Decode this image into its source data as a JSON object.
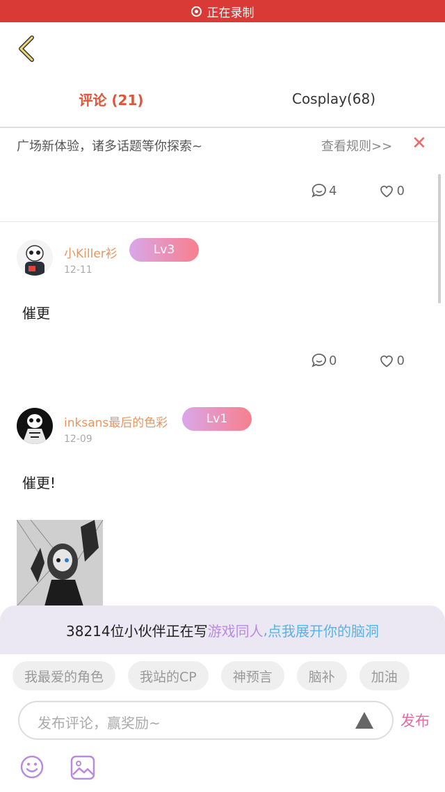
{
  "recording": {
    "label": "正在录制"
  },
  "tabs": [
    {
      "label": "评论 (21)"
    },
    {
      "label": "Cosplay(68)"
    }
  ],
  "notice": {
    "text": "广场新体验，诸多话题等你探索~",
    "rules": "查看规则>>",
    "close": "✕"
  },
  "post0": {
    "comments": "4",
    "likes": "0"
  },
  "comments": [
    {
      "user": "小Killer衫",
      "level": "Lv3",
      "date": "12-11",
      "text": "催更",
      "comments": "0",
      "likes": "0"
    },
    {
      "user": "inksans最后的色彩",
      "level": "Lv1",
      "date": "12-09",
      "text": "催更!"
    }
  ],
  "bottom": {
    "banner_prefix": "38214位小伙伴正在写",
    "banner_hl1": "游戏同人",
    "banner_sep": ",",
    "banner_hl2": "点我展开你的脑洞",
    "topics": [
      "我最爱的角色",
      "我站的CP",
      "神预言",
      "脑补",
      "加油"
    ],
    "input_placeholder": "发布评论，赢奖励~",
    "publish": "发布"
  },
  "colors": {
    "accent": "#e0553a",
    "recording_bar": "#d93a36",
    "username": "#e8955f",
    "publish": "#e16aa6"
  }
}
